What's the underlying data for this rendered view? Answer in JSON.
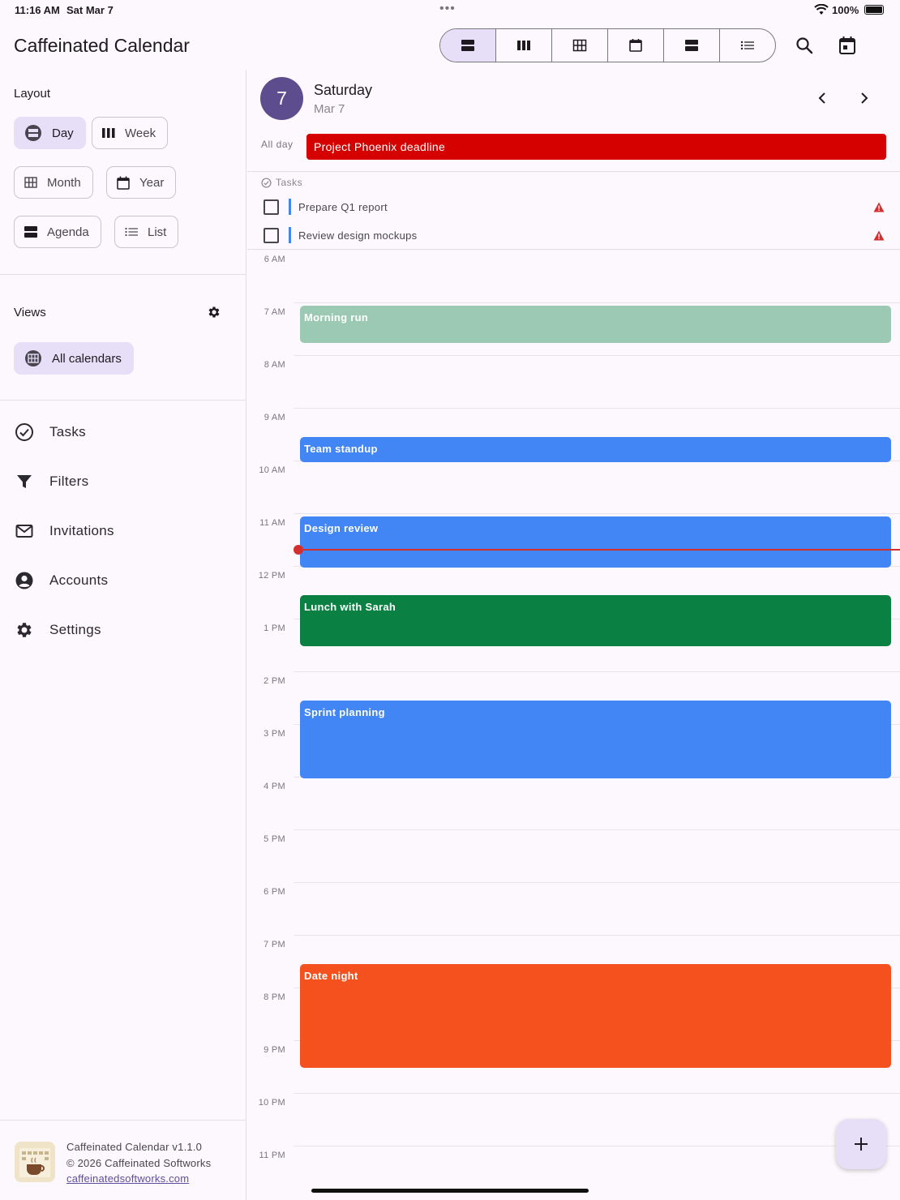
{
  "status_bar": {
    "time": "11:16 AM",
    "date": "Sat Mar 7",
    "battery": "100%"
  },
  "app": {
    "title": "Caffeinated Calendar"
  },
  "sidebar": {
    "layout_label": "Layout",
    "layouts": [
      {
        "label": "Day",
        "icon": "day-view-icon",
        "active": true
      },
      {
        "label": "Week",
        "icon": "week-view-icon"
      },
      {
        "label": "Month",
        "icon": "month-view-icon"
      },
      {
        "label": "Year",
        "icon": "year-view-icon"
      },
      {
        "label": "Agenda",
        "icon": "agenda-view-icon"
      },
      {
        "label": "List",
        "icon": "list-view-icon"
      }
    ],
    "views_label": "Views",
    "views": [
      {
        "label": "All calendars",
        "icon": "calendars-icon",
        "active": true
      }
    ],
    "nav": [
      {
        "label": "Tasks",
        "icon": "check-circle-icon"
      },
      {
        "label": "Filters",
        "icon": "filter-icon"
      },
      {
        "label": "Invitations",
        "icon": "envelope-icon"
      },
      {
        "label": "Accounts",
        "icon": "account-icon"
      },
      {
        "label": "Settings",
        "icon": "gear-icon"
      }
    ],
    "footer": {
      "version": "Caffeinated Calendar v1.1.0",
      "copyright": "© 2026 Caffeinated Softworks",
      "link": "caffeinatedsoftworks.com"
    }
  },
  "day_header": {
    "day_number": "7",
    "day_name": "Saturday",
    "date": "Mar 7"
  },
  "all_day": {
    "label": "All day",
    "event": "Project Phoenix deadline",
    "color": "#d50000"
  },
  "tasks": {
    "label": "Tasks",
    "items": [
      {
        "title": "Prepare Q1 report",
        "color": "#4285f4"
      },
      {
        "title": "Review design mockups",
        "color": "#4285f4"
      }
    ]
  },
  "hours": [
    "6 AM",
    "7 AM",
    "8 AM",
    "9 AM",
    "10 AM",
    "11 AM",
    "12 PM",
    "1 PM",
    "2 PM",
    "3 PM",
    "4 PM",
    "5 PM",
    "6 PM",
    "7 PM",
    "8 PM",
    "9 PM",
    "10 PM",
    "11 PM"
  ],
  "events": [
    {
      "title": "Morning run",
      "start": 6.5,
      "end": 7.25,
      "color": "#9cc9b3"
    },
    {
      "title": "Team standup",
      "start": 9.0,
      "end": 9.5,
      "color": "#4285f4"
    },
    {
      "title": "Design review",
      "start": 10.5,
      "end": 11.5,
      "color": "#4285f4"
    },
    {
      "title": "Lunch with Sarah",
      "start": 12.0,
      "end": 13.0,
      "color": "#0b8043"
    },
    {
      "title": "Sprint planning",
      "start": 14.0,
      "end": 15.5,
      "color": "#4285f4"
    },
    {
      "title": "Date night",
      "start": 19.0,
      "end": 21.0,
      "color": "#f4511e"
    }
  ],
  "current_time": 11.25
}
